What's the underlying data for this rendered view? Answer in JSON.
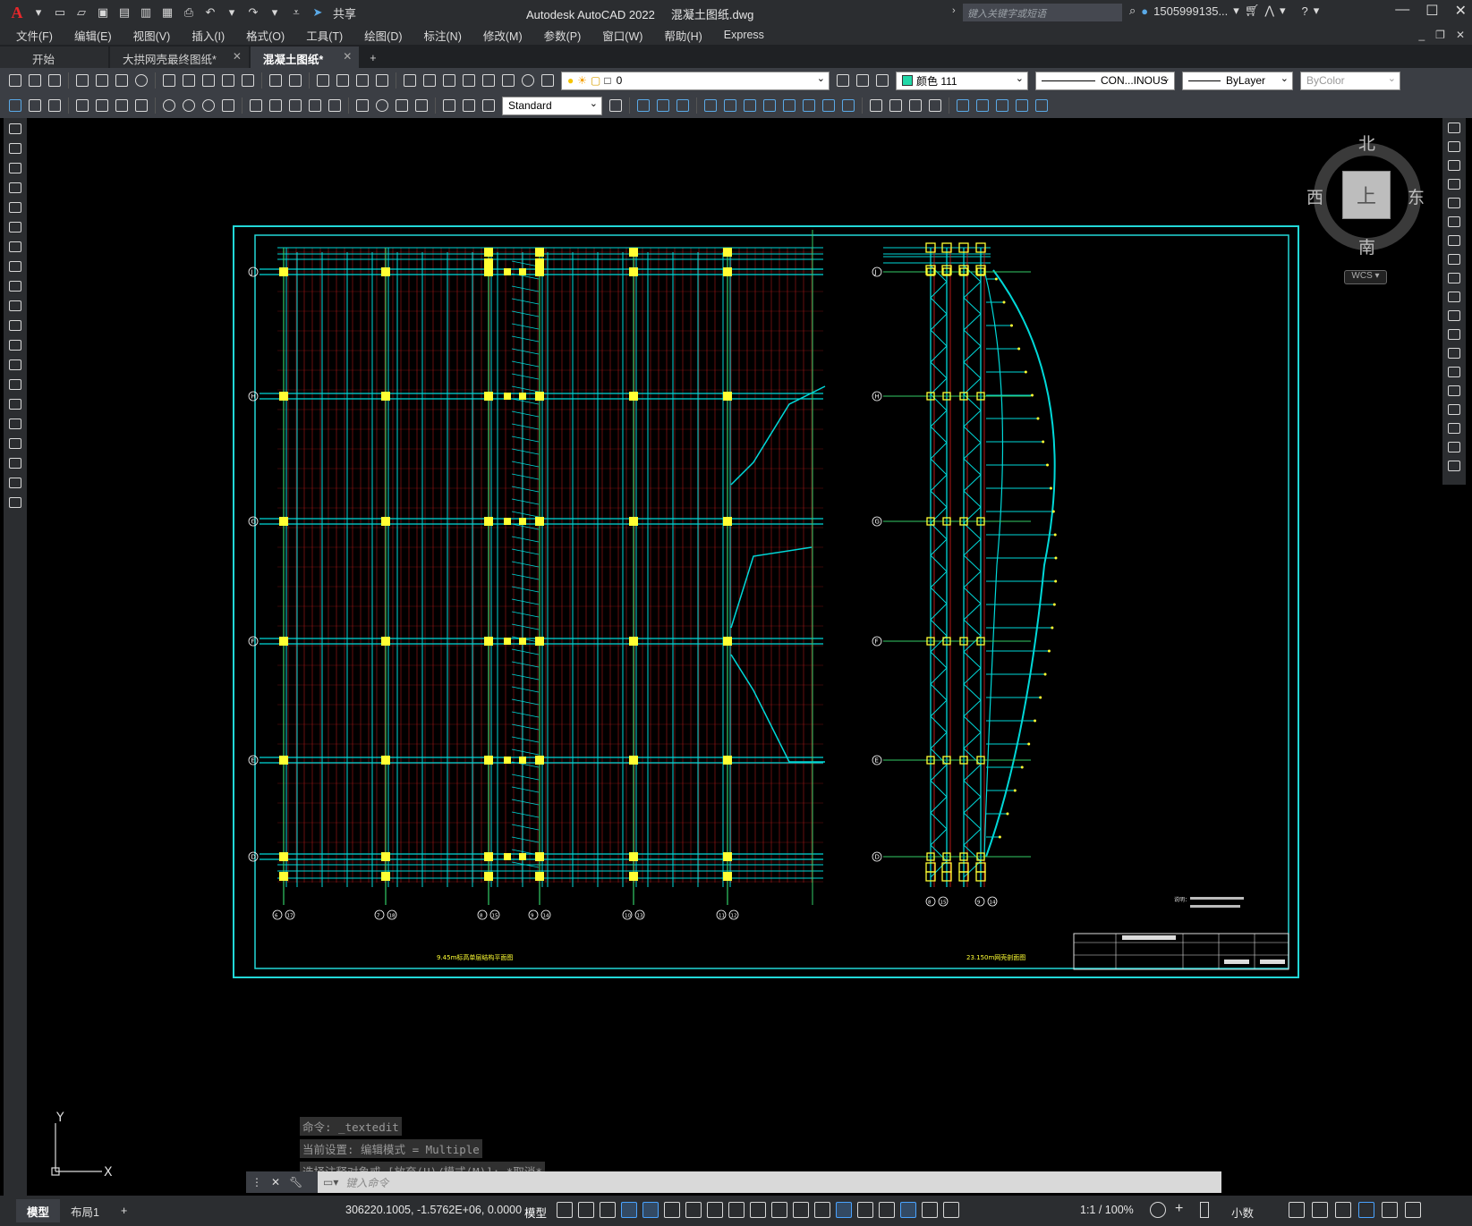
{
  "titlebar": {
    "app_logo": "A",
    "share_label": "共享",
    "app_name": "Autodesk AutoCAD 2022",
    "file_name": "混凝土图纸.dwg",
    "search_placeholder": "键入关键字或短语",
    "user_name": "1505999135...",
    "controls": [
      "—",
      "☐",
      "✕"
    ]
  },
  "menubar": {
    "items": [
      "文件(F)",
      "编辑(E)",
      "视图(V)",
      "插入(I)",
      "格式(O)",
      "工具(T)",
      "绘图(D)",
      "标注(N)",
      "修改(M)",
      "参数(P)",
      "窗口(W)",
      "帮助(H)",
      "Express"
    ]
  },
  "tabs": {
    "items": [
      {
        "label": "开始",
        "closable": false,
        "active": false
      },
      {
        "label": "大拱网壳最终图纸*",
        "closable": true,
        "active": false
      },
      {
        "label": "混凝土图纸*",
        "closable": true,
        "active": true
      }
    ],
    "add_label": "+"
  },
  "toolbar1": {
    "layer_value": "0",
    "color_value": "颜色 111",
    "linetype_value": "CON...INOUS",
    "lineweight_value": "ByLayer",
    "plotstyle_value": "ByColor"
  },
  "toolbar2": {
    "textstyle_value": "Standard"
  },
  "viewcube": {
    "north": "北",
    "south": "南",
    "east": "东",
    "west": "西",
    "face": "上",
    "wcs_label": "WCS"
  },
  "ucs": {
    "x_label": "X",
    "y_label": "Y"
  },
  "drawing": {
    "plan_axis_labels_left": [
      "J",
      "H",
      "G",
      "F",
      "E",
      "D"
    ],
    "plan_axis_labels_bottom": [
      "6 17",
      "7 18",
      "8 15",
      "9 14",
      "10 13",
      "11 12"
    ],
    "section_axis_labels_bottom": [
      "8 15",
      "9 14"
    ],
    "plan_title": "9.45m标高单层结构平面图",
    "section_title": "23.150m网壳剖面图",
    "notes_heading": "说明："
  },
  "command": {
    "history": [
      "命令: _textedit",
      "当前设置: 编辑模式 = Multiple",
      "选择注释对象或 [放弃(U)/模式(M)]: *取消*"
    ],
    "placeholder": "键入命令"
  },
  "statusbar": {
    "tabs": [
      "模型",
      "布局1"
    ],
    "add_label": "+",
    "coords": "306220.1005, -1.5762E+06, 0.0000",
    "space": "模型",
    "scale": "1:1 / 100%",
    "units": "小数"
  },
  "colors": {
    "grid_cyan": "#00d8d8",
    "beam_red": "#e02020",
    "column_yellow": "#ffff33",
    "frame_cyan": "#22d8d8",
    "canvas_bg": "#000000"
  }
}
